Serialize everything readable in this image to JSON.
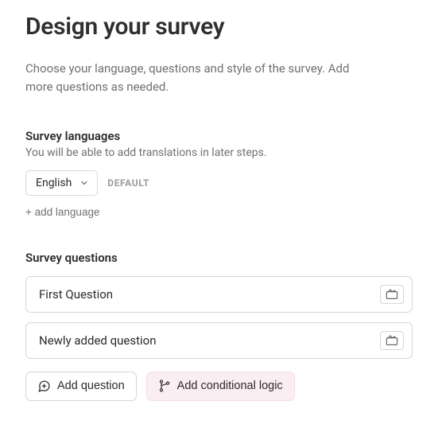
{
  "title": "Design your survey",
  "description": "Choose your language, questions and style of the survey. Add more questions as needed.",
  "languages": {
    "section_label": "Survey languages",
    "hint": "You will be able to add translations in later steps.",
    "selected": "English",
    "default_tag": "DEFAULT",
    "add_language_label": "+ add language"
  },
  "questions": {
    "section_label": "Survey questions",
    "items": [
      {
        "title": "First Question"
      },
      {
        "title": "Newly added question"
      }
    ]
  },
  "actions": {
    "add_question": "Add question",
    "add_conditional_logic": "Add conditional logic"
  }
}
